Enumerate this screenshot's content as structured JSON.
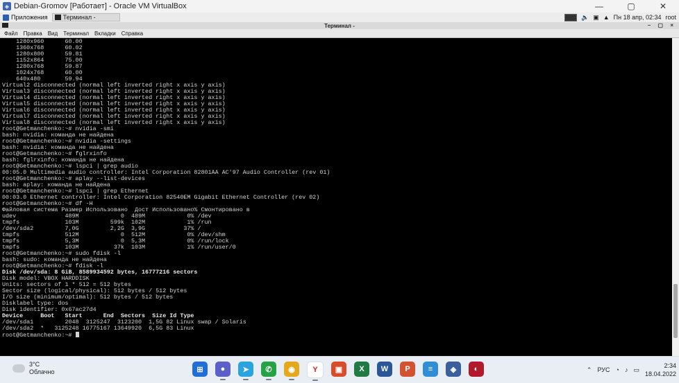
{
  "vbox": {
    "title": "Debian-Gromov [Работает] - Oracle VM VirtualBox",
    "min": "—",
    "max": "▢",
    "close": "✕"
  },
  "guest_panel": {
    "apps_label": "Приложения",
    "task_label": "Терминал -",
    "clock": "Пн 18 апр, 02:34",
    "user": "root"
  },
  "terminal": {
    "title": "Терминал -",
    "controls": "– ▢ ×",
    "menu": [
      "Файл",
      "Правка",
      "Вид",
      "Терминал",
      "Вкладки",
      "Справка"
    ],
    "lines": [
      "    1280x960      60.00",
      "    1360x768      60.02",
      "    1280x800      59.81",
      "    1152x864      75.00",
      "    1280x768      59.87",
      "    1024x768      60.00",
      "    640x480       59.94",
      "Virtual2 disconnected (normal left inverted right x axis y axis)",
      "Virtual3 disconnected (normal left inverted right x axis y axis)",
      "Virtual4 disconnected (normal left inverted right x axis y axis)",
      "Virtual5 disconnected (normal left inverted right x axis y axis)",
      "Virtual6 disconnected (normal left inverted right x axis y axis)",
      "Virtual7 disconnected (normal left inverted right x axis y axis)",
      "Virtual8 disconnected (normal left inverted right x axis y axis)",
      "root@Getmanchenko:~# nvidia -smi",
      "bash: nvidia: команда не найдена",
      "root@Getmanchenko:~# nvidia -settings",
      "bash: nvidia: команда не найдена",
      "root@Getmanchenko:~# fglrxinfo",
      "bash: fglrxinfo: команда не найдена",
      "root@Getmanchenko:~# lspci | grep audio",
      "00:05.0 Multimedia audio controller: Intel Corporation 82801AA AC'97 Audio Controller (rev 01)",
      "root@Getmanchenko:~# aplay --list-devices",
      "bash: aplay: команда не найдена",
      "root@Getmanchenko:~# lspci | grep Ethernet",
      "00:03.0 Ethernet controller: Intel Corporation 82540EM Gigabit Ethernet Controller (rev 02)",
      "root@Getmanchenko:~# df -H",
      "Файловая система Размер Использовано  Дост Использовано% Смонтировано в",
      "udev              489M            0  489M            0% /dev",
      "tmpfs             103M         599k  102M            1% /run",
      "/dev/sda2         7,0G         2,2G  3,9G           37% /",
      "tmpfs             512M            0  512M            0% /dev/shm",
      "tmpfs             5,3M            0  5,3M            0% /run/lock",
      "tmpfs             103M          37k  103M            1% /run/user/0",
      "root@Getmanchenko:~# sudo fdisk -l",
      "bash: sudo: команда не найдена",
      "root@Getmanchenko:~# fdisk -l",
      "",
      "",
      "Disk /dev/sda: 8 GiB, 8589934592 bytes, 16777216 sectors",
      "Disk model: VBOX HARDDISK",
      "Units: sectors of 1 * 512 = 512 bytes",
      "Sector size (logical/physical): 512 bytes / 512 bytes",
      "I/O size (minimum/optimal): 512 bytes / 512 bytes",
      "Disklabel type: dos",
      "Disk identifier: 0x67ac27d4",
      "",
      "Device     Boot   Start      End  Sectors  Size Id Type",
      "/dev/sda1         2048  3125247  3123200  1,5G 82 Linux swap / Solaris",
      "/dev/sda2  *   3125248 16775167 13649920  6,5G 83 Linux",
      "root@Getmanchenko:~# "
    ],
    "bold_lines": [
      39,
      47
    ]
  },
  "taskbar": {
    "weather_temp": "3°C",
    "weather_desc": "Облачно",
    "lang": "РУС",
    "time": "2:34",
    "date": "18.04.2022",
    "apps": [
      {
        "name": "start-icon",
        "color": "#1f6fd6",
        "glyph": "⊞"
      },
      {
        "name": "chat-icon",
        "color": "#5b5fc7",
        "glyph": "●"
      },
      {
        "name": "telegram-icon",
        "color": "#2aa3df",
        "glyph": "➤"
      },
      {
        "name": "whatsapp-icon",
        "color": "#25a244",
        "glyph": "✆"
      },
      {
        "name": "chrome-icon",
        "color": "#e5a81c",
        "glyph": "◉"
      },
      {
        "name": "yandex-icon",
        "color": "#ffffff",
        "glyph": "Y"
      },
      {
        "name": "image-viewer-icon",
        "color": "#d84c2c",
        "glyph": "▣"
      },
      {
        "name": "excel-icon",
        "color": "#1f7a43",
        "glyph": "X"
      },
      {
        "name": "word-icon",
        "color": "#2b5797",
        "glyph": "W"
      },
      {
        "name": "powerpoint-icon",
        "color": "#d35230",
        "glyph": "P"
      },
      {
        "name": "notepad-icon",
        "color": "#2f8ed6",
        "glyph": "≡"
      },
      {
        "name": "virtualbox-icon",
        "color": "#3a5f9c",
        "glyph": "◈"
      },
      {
        "name": "app-red-icon",
        "color": "#b01a2b",
        "glyph": "◐"
      }
    ]
  }
}
